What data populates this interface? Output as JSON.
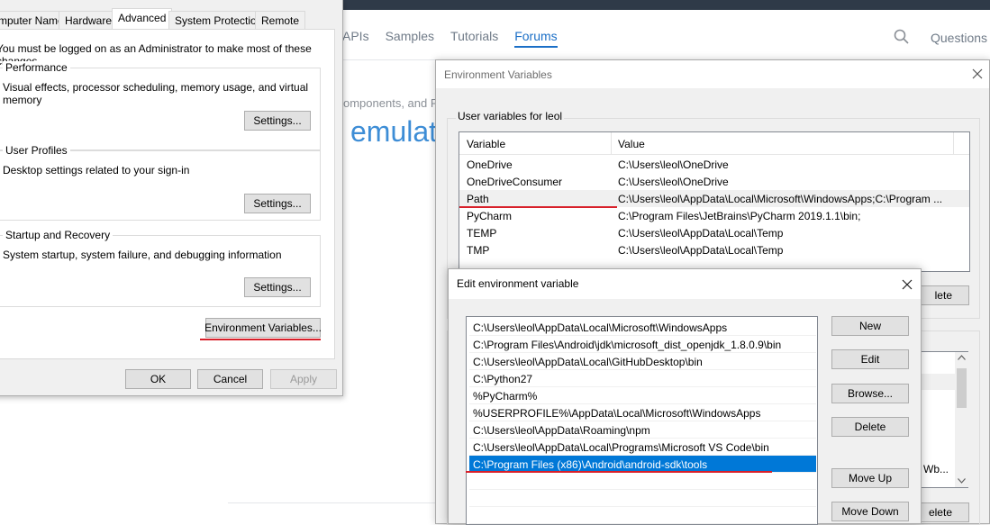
{
  "web": {
    "nav": [
      "APIs",
      "Samples",
      "Tutorials",
      "Forums"
    ],
    "active_nav": "Forums",
    "questions": "Questions",
    "subtext": "omponents, and F",
    "heading": "emulat"
  },
  "sysprops": {
    "tabs": [
      "mputer Name",
      "Hardware",
      "Advanced",
      "System Protection",
      "Remote"
    ],
    "active_tab": "Advanced",
    "admin_note": "You must be logged on as an Administrator to make most of these changes.",
    "groups": [
      {
        "title": "Performance",
        "desc": "Visual effects, processor scheduling, memory usage, and virtual memory",
        "button": "Settings..."
      },
      {
        "title": "User Profiles",
        "desc": "Desktop settings related to your sign-in",
        "button": "Settings..."
      },
      {
        "title": "Startup and Recovery",
        "desc": "System startup, system failure, and debugging information",
        "button": "Settings..."
      }
    ],
    "env_button": "Environment Variables...",
    "ok": "OK",
    "cancel": "Cancel",
    "apply": "Apply"
  },
  "envvars": {
    "title": "Environment Variables",
    "user_vars_title": "User variables for leol",
    "columns": [
      "Variable",
      "Value"
    ],
    "rows": [
      {
        "variable": "OneDrive",
        "value": "C:\\Users\\leol\\OneDrive"
      },
      {
        "variable": "OneDriveConsumer",
        "value": "C:\\Users\\leol\\OneDrive"
      },
      {
        "variable": "Path",
        "value": "C:\\Users\\leol\\AppData\\Local\\Microsoft\\WindowsApps;C:\\Program ..."
      },
      {
        "variable": "PyCharm",
        "value": "C:\\Program Files\\JetBrains\\PyCharm 2019.1.1\\bin;"
      },
      {
        "variable": "TEMP",
        "value": "C:\\Users\\leol\\AppData\\Local\\Temp"
      },
      {
        "variable": "TMP",
        "value": "C:\\Users\\leol\\AppData\\Local\\Temp"
      }
    ],
    "selected_row": "Path",
    "delete_partial": "lete",
    "delete_partial2": "elete",
    "sysvar_partial": "Wb..."
  },
  "editenv": {
    "title": "Edit environment variable",
    "paths": [
      "C:\\Users\\leol\\AppData\\Local\\Microsoft\\WindowsApps",
      "C:\\Program Files\\Android\\jdk\\microsoft_dist_openjdk_1.8.0.9\\bin",
      "C:\\Users\\leol\\AppData\\Local\\GitHubDesktop\\bin",
      "C:\\Python27",
      "%PyCharm%",
      "%USERPROFILE%\\AppData\\Local\\Microsoft\\WindowsApps",
      "C:\\Users\\leol\\AppData\\Roaming\\npm",
      "C:\\Users\\leol\\AppData\\Local\\Programs\\Microsoft VS Code\\bin",
      "C:\\Program Files (x86)\\Android\\android-sdk\\tools"
    ],
    "selected_index": 8,
    "buttons": {
      "new": "New",
      "edit": "Edit",
      "browse": "Browse...",
      "delete": "Delete",
      "move_up": "Move Up",
      "move_down": "Move Down"
    }
  },
  "colors": {
    "accent": "#0078d7",
    "annotation": "#d8202a",
    "link": "#1b6fc7"
  }
}
